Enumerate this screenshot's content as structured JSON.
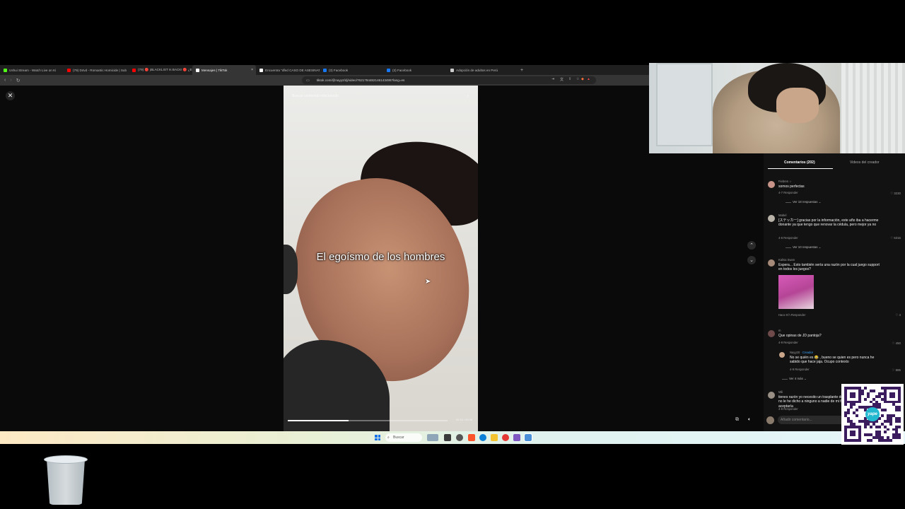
{
  "browser": {
    "tabs": [
      {
        "title": "Ushui Stream - Watch Live on Ki",
        "favicon_color": "#53fc18",
        "active": false
      },
      {
        "title": "(79) D4vd - Romantic Homicide | Sub",
        "favicon_color": "#ff0000",
        "active": false
      },
      {
        "title": "(79) 🔴 ¡BLACKLIST Is BACK! 🔴 ¿En",
        "favicon_color": "#ff0000",
        "active": false
      },
      {
        "title": "Mensajes | TikTok",
        "favicon_color": "#ffffff",
        "active": true
      },
      {
        "title": "Encuentra \"dfed CASO DE ASESINAT",
        "favicon_color": "#ffffff",
        "active": false
      },
      {
        "title": "(3) Facebook",
        "favicon_color": "#1877f2",
        "active": false
      },
      {
        "title": "(3) Facebook",
        "favicon_color": "#1877f2",
        "active": false
      },
      {
        "title": "Adopción de adultos en Perú",
        "favicon_color": "#cccccc",
        "active": false
      }
    ],
    "new_tab": "+",
    "url": "tiktok.com/@nayy2/dj/video/7621784482146143495?lang=es"
  },
  "viewer": {
    "close_icon": "✕",
    "search_placeholder": "Buscar contenido relacionado",
    "caption": "El egoísmo de los hombres",
    "progress": 0.38,
    "time": "00:14 / 00:38",
    "nav_up_icon": "chevron-up-icon",
    "nav_down_icon": "chevron-down-icon"
  },
  "panel": {
    "tab_comments": "Comentarios (202)",
    "tab_creator_videos": "Videos del creador",
    "comments": [
      {
        "user": "Fiebres ☆",
        "text": "somos perfectas",
        "meta": "4-7  Responder",
        "likes": "3230",
        "more": "Ver 18 respuestas",
        "avatar_color": "#c8948a"
      },
      {
        "user": "Mabel",
        "text": "[ステッカー] gracias por la información, este año iba a hacerme donante ya que tengo que renovar la cédula, pero mejor ya no",
        "meta": "4-6  Responder",
        "likes": "5316",
        "more": "Ver 10 respuestas",
        "avatar_color": "#b9b2a8"
      },
      {
        "user": "Kalisa Swan",
        "text": "Espera... Esto también sería una razón por la cual juego support en todos los juegos?",
        "meta": "Hace 8 h  Responder",
        "likes": "4",
        "avatar_color": "#a58a7a"
      },
      {
        "user": "m",
        "text": "Que opinas de JD pantoja?",
        "meta": "4-9  Responder",
        "likes": "450",
        "avatar_color": "#6e4a4a"
      },
      {
        "user": "Nayy20",
        "badge": "· Creador",
        "text": "No se quién es 😂 , bueno se quien es pero nunca he sabido que hace jaja. Ocupo contexto",
        "meta": "4-9  Responder",
        "likes": "885",
        "more": "Ver 4 más",
        "avatar_color": "#c9a68a"
      },
      {
        "user": "Mili",
        "text": "tienes razón yo necesito un trasplante de riñón y no le he dicho a ninguno a nadie de mi familia ni aceptaría",
        "meta": "4-8  Responder",
        "avatar_color": "#9a8f85"
      }
    ],
    "input_placeholder": "Añadir comentario..."
  },
  "taskbar": {
    "search_placeholder": "Buscar"
  },
  "qr": {
    "logo_text": "yape"
  }
}
